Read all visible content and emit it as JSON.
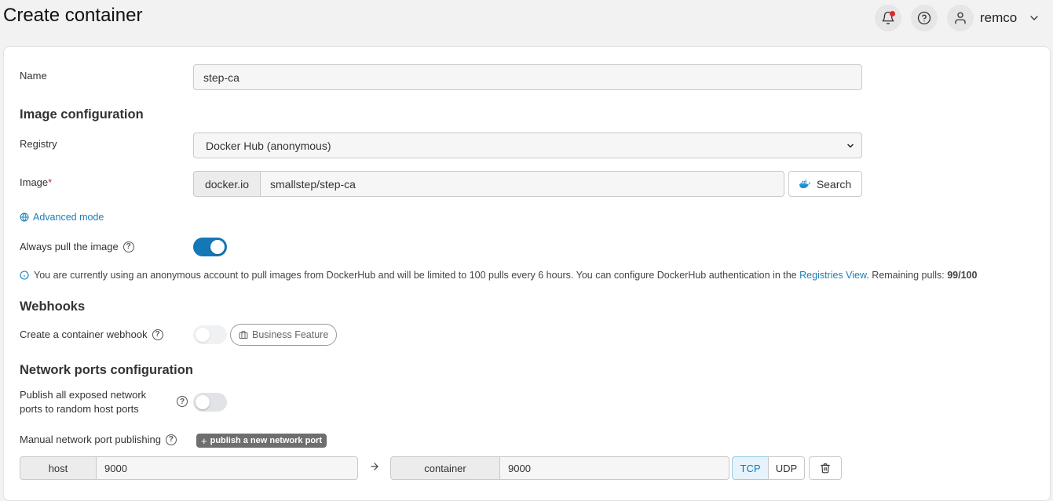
{
  "header": {
    "title": "Create container",
    "user_name": "remco",
    "notification_badge_color": "#e0262b"
  },
  "form": {
    "name_label": "Name",
    "name_value": "step-ca",
    "image_config_title": "Image configuration",
    "registry_label": "Registry",
    "registry_value": "Docker Hub (anonymous)",
    "image_label": "Image",
    "image_required_mark": "*",
    "image_prefix": "docker.io",
    "image_value": "smallstep/step-ca",
    "search_button": "Search",
    "advanced_mode_link": "Advanced mode",
    "always_pull_label": "Always pull the image",
    "always_pull_enabled": true,
    "pull_info_text": "You are currently using an anonymous account to pull images from DockerHub and will be limited to 100 pulls every 6 hours. You can configure DockerHub authentication in the",
    "pull_info_link": "Registries View",
    "pull_info_suffix": ". Remaining pulls:",
    "remaining_pulls": "99/100"
  },
  "webhooks": {
    "title": "Webhooks",
    "create_label": "Create a container webhook",
    "enabled": false,
    "business_badge": "Business Feature"
  },
  "network": {
    "title": "Network ports configuration",
    "publish_all_label_line1": "Publish all exposed network",
    "publish_all_label_line2": "ports to random host ports",
    "publish_all_enabled": false,
    "manual_label": "Manual network port publishing",
    "publish_new_button": "publish a new network port",
    "ports": [
      {
        "host_label": "host",
        "host_value": "9000",
        "container_label": "container",
        "container_value": "9000",
        "protocol_tcp": "TCP",
        "protocol_udp": "UDP",
        "selected_protocol": "TCP"
      }
    ]
  },
  "colors": {
    "accent": "#1477b8",
    "link": "#1a7fb7",
    "required": "#c0262d"
  }
}
